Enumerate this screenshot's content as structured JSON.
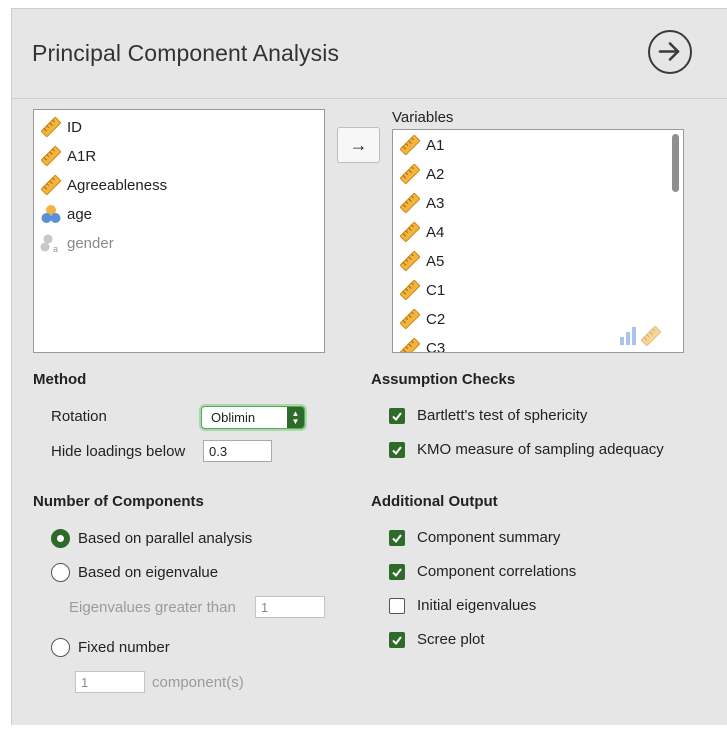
{
  "header": {
    "title": "Principal Component Analysis"
  },
  "source_list": {
    "items": [
      {
        "label": "ID",
        "icon": "ruler-icon",
        "dim": false
      },
      {
        "label": "A1R",
        "icon": "ruler-icon",
        "dim": false
      },
      {
        "label": "Agreeableness",
        "icon": "ruler-icon",
        "dim": false
      },
      {
        "label": "age",
        "icon": "ordinal-icon",
        "dim": false
      },
      {
        "label": "gender",
        "icon": "nominal-text-icon",
        "dim": true
      }
    ]
  },
  "move_button": {
    "label": "→"
  },
  "variables": {
    "title": "Variables",
    "items": [
      "A1",
      "A2",
      "A3",
      "A4",
      "A5",
      "C1",
      "C2",
      "C3"
    ]
  },
  "method": {
    "title": "Method",
    "rotation_label": "Rotation",
    "rotation_value": "Oblimin",
    "hide_label": "Hide loadings below",
    "hide_value": "0.3"
  },
  "assumption": {
    "title": "Assumption Checks",
    "items": [
      {
        "label": "Bartlett's test of sphericity",
        "checked": true
      },
      {
        "label": "KMO measure of sampling adequacy",
        "checked": true
      }
    ]
  },
  "components": {
    "title": "Number of Components",
    "parallel_label": "Based on parallel analysis",
    "eigen_label": "Based on eigenvalue",
    "eigen_greater_label": "Eigenvalues greater than",
    "eigen_greater_value": "1",
    "fixed_label": "Fixed number",
    "fixed_value": "1",
    "fixed_suffix": "component(s)",
    "selected": "parallel"
  },
  "additional": {
    "title": "Additional Output",
    "items": [
      {
        "label": "Component summary",
        "checked": true
      },
      {
        "label": "Component correlations",
        "checked": true
      },
      {
        "label": "Initial eigenvalues",
        "checked": false
      },
      {
        "label": "Scree plot",
        "checked": true
      }
    ]
  },
  "colors": {
    "accent": "#2e6b2a",
    "ruler": "#f0a830",
    "ordinal": "#5b8fd6"
  }
}
